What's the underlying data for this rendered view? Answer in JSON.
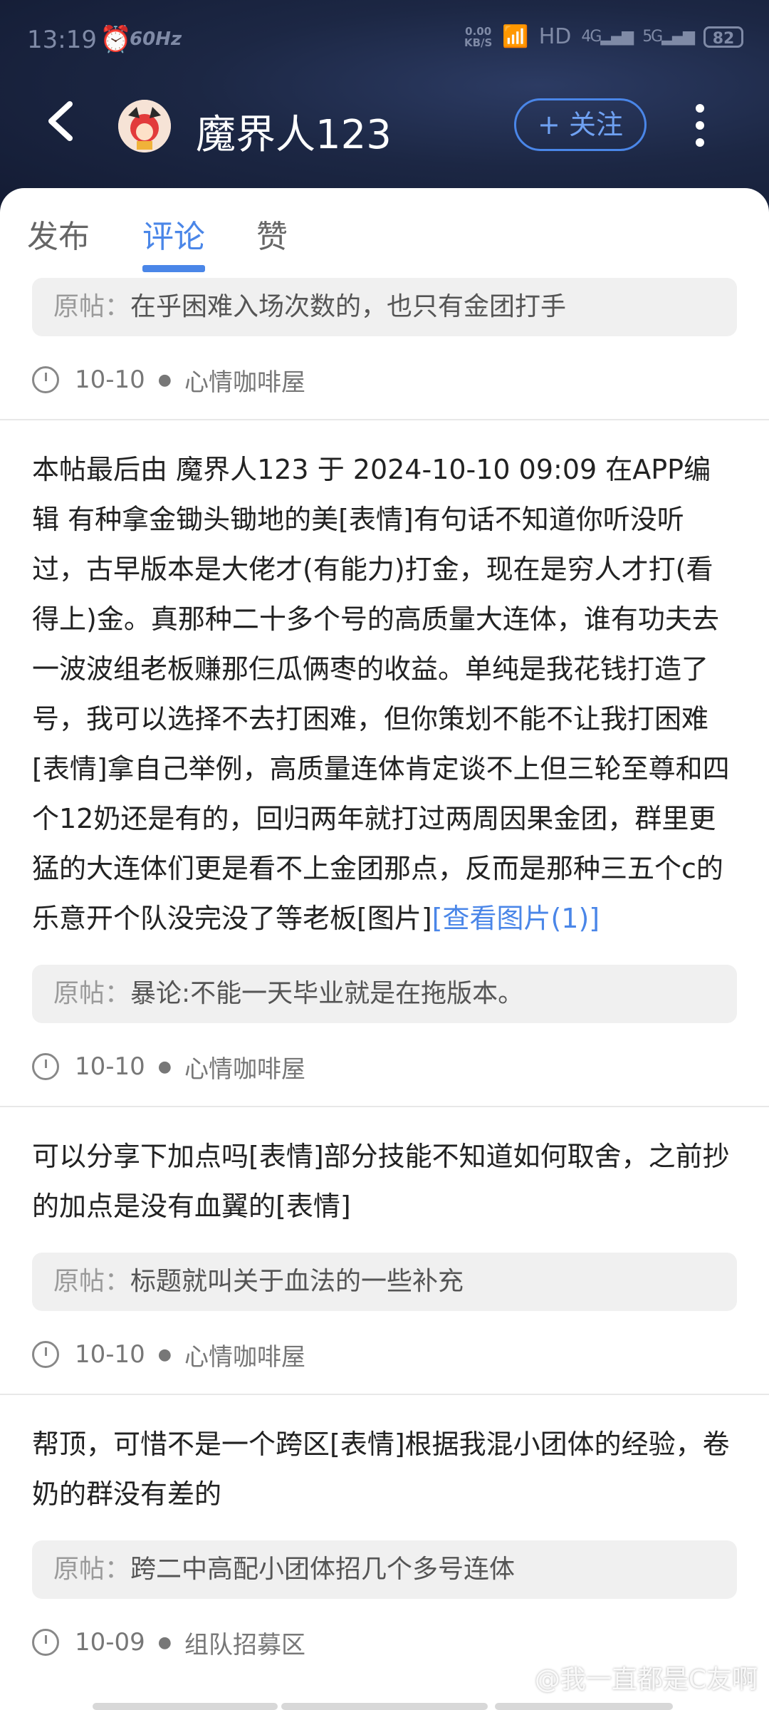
{
  "status_bar": {
    "time": "13:19",
    "refresh": "60Hz",
    "net_speed_value": "0.00",
    "net_speed_unit": "KB/S",
    "hd": "HD",
    "sig1": "4G",
    "sig2": "5G",
    "battery": "82"
  },
  "nav": {
    "username": "魔界人123",
    "follow_label": "+ 关注"
  },
  "tabs": [
    {
      "label": "发布"
    },
    {
      "label": "评论"
    },
    {
      "label": "赞"
    }
  ],
  "orig_prefix": "原帖：",
  "comments": [
    {
      "text": "",
      "orig": "在乎困难入场次数的，也只有金团打手",
      "date": "10-10",
      "board": "心情咖啡屋"
    },
    {
      "text": "本帖最后由 魔界人123 于 2024-10-10 09:09 在APP编辑 有种拿金锄头锄地的美[表情]有句话不知道你听没听过，古早版本是大佬才(有能力)打金，现在是穷人才打(看得上)金。真那种二十多个号的高质量大连体，谁有功夫去一波波组老板赚那仨瓜俩枣的收益。单纯是我花钱打造了号，我可以选择不去打困难，但你策划不能不让我打困难[表情]拿自己举例，高质量连体肯定谈不上但三轮至尊和四个12奶还是有的，回归两年就打过两周因果金团，群里更猛的大连体们更是看不上金团那点，反而是那种三五个c的乐意开个队没完没了等老板[图片]",
      "link": "[查看图片(1)]",
      "orig": "暴论:不能一天毕业就是在拖版本。",
      "date": "10-10",
      "board": "心情咖啡屋"
    },
    {
      "text": "可以分享下加点吗[表情]部分技能不知道如何取舍，之前抄的加点是没有血翼的[表情]",
      "orig": "标题就叫关于血法的一些补充",
      "date": "10-10",
      "board": "心情咖啡屋"
    },
    {
      "text": "帮顶，可惜不是一个跨区[表情]根据我混小团体的经验，卷奶的群没有差的",
      "orig": "跨二中高配小团体招几个多号连体",
      "date": "10-09",
      "board": "组队招募区"
    }
  ],
  "watermark": "@我一直都是C友啊",
  "colors": {
    "accent": "#4a86e8",
    "header_bg": "#1c2744"
  }
}
